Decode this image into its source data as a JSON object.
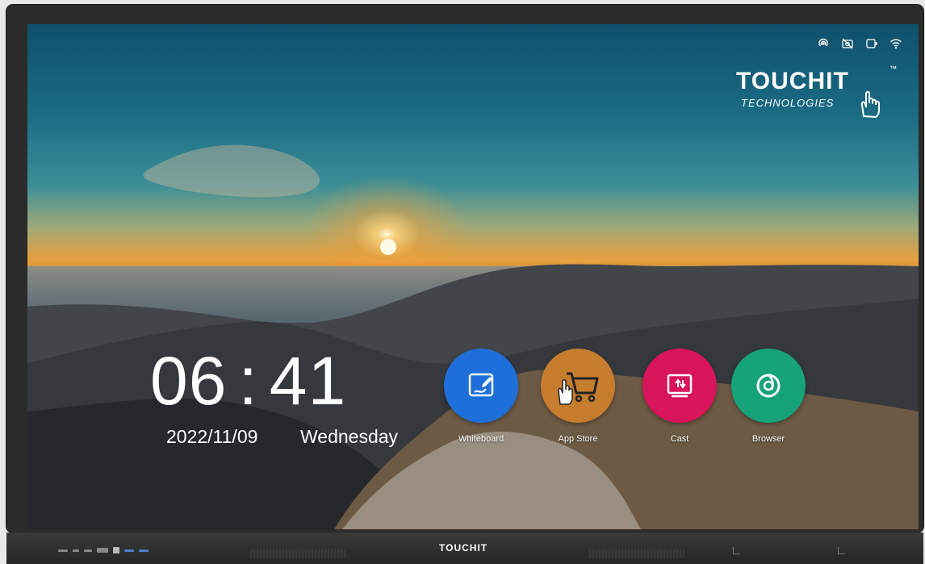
{
  "status_bar": {
    "icons": [
      "hotspot-icon",
      "no-camera-icon",
      "screen-share-icon",
      "wifi-icon"
    ]
  },
  "brand": {
    "name": "TOUCHIT",
    "tagline": "TECHNOLOGIES",
    "tm": "™"
  },
  "clock": {
    "hours": "06",
    "separator": ":",
    "minutes": "41",
    "date": "2022/11/09",
    "weekday": "Wednesday"
  },
  "apps": [
    {
      "label": "Whiteboard",
      "icon": "whiteboard-icon",
      "color": "#1e6fd9"
    },
    {
      "label": "App Store",
      "icon": "shopping-cart-icon",
      "color": "#c77d2e"
    },
    {
      "label": "Cast",
      "icon": "cast-icon",
      "color": "#d8145a"
    },
    {
      "label": "Browser",
      "icon": "browser-icon",
      "color": "#16a37a"
    }
  ],
  "bezel": {
    "logo": "TOUCHIT"
  }
}
